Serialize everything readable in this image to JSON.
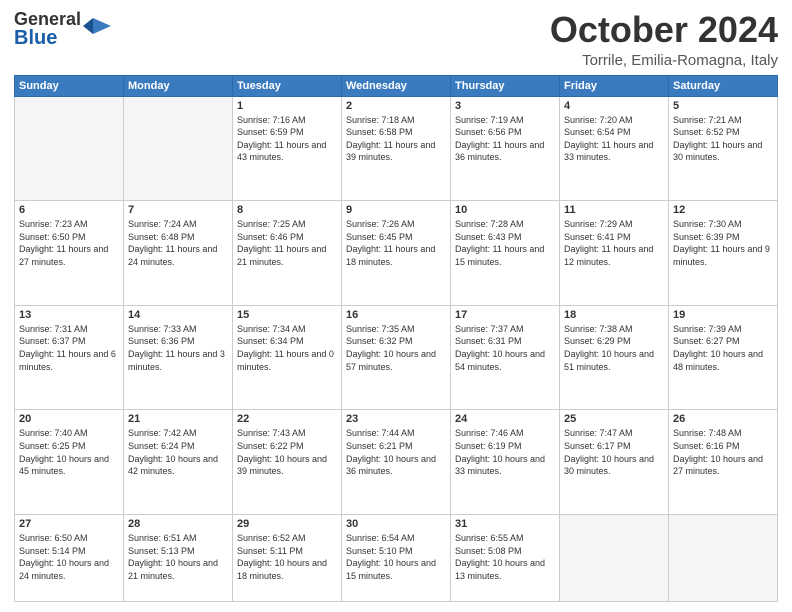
{
  "logo": {
    "general": "General",
    "blue": "Blue"
  },
  "header": {
    "month": "October 2024",
    "location": "Torrile, Emilia-Romagna, Italy"
  },
  "weekdays": [
    "Sunday",
    "Monday",
    "Tuesday",
    "Wednesday",
    "Thursday",
    "Friday",
    "Saturday"
  ],
  "weeks": [
    [
      {
        "day": "",
        "sunrise": "",
        "sunset": "",
        "daylight": "",
        "empty": true
      },
      {
        "day": "",
        "sunrise": "",
        "sunset": "",
        "daylight": "",
        "empty": true
      },
      {
        "day": "1",
        "sunrise": "Sunrise: 7:16 AM",
        "sunset": "Sunset: 6:59 PM",
        "daylight": "Daylight: 11 hours and 43 minutes.",
        "empty": false
      },
      {
        "day": "2",
        "sunrise": "Sunrise: 7:18 AM",
        "sunset": "Sunset: 6:58 PM",
        "daylight": "Daylight: 11 hours and 39 minutes.",
        "empty": false
      },
      {
        "day": "3",
        "sunrise": "Sunrise: 7:19 AM",
        "sunset": "Sunset: 6:56 PM",
        "daylight": "Daylight: 11 hours and 36 minutes.",
        "empty": false
      },
      {
        "day": "4",
        "sunrise": "Sunrise: 7:20 AM",
        "sunset": "Sunset: 6:54 PM",
        "daylight": "Daylight: 11 hours and 33 minutes.",
        "empty": false
      },
      {
        "day": "5",
        "sunrise": "Sunrise: 7:21 AM",
        "sunset": "Sunset: 6:52 PM",
        "daylight": "Daylight: 11 hours and 30 minutes.",
        "empty": false
      }
    ],
    [
      {
        "day": "6",
        "sunrise": "Sunrise: 7:23 AM",
        "sunset": "Sunset: 6:50 PM",
        "daylight": "Daylight: 11 hours and 27 minutes.",
        "empty": false
      },
      {
        "day": "7",
        "sunrise": "Sunrise: 7:24 AM",
        "sunset": "Sunset: 6:48 PM",
        "daylight": "Daylight: 11 hours and 24 minutes.",
        "empty": false
      },
      {
        "day": "8",
        "sunrise": "Sunrise: 7:25 AM",
        "sunset": "Sunset: 6:46 PM",
        "daylight": "Daylight: 11 hours and 21 minutes.",
        "empty": false
      },
      {
        "day": "9",
        "sunrise": "Sunrise: 7:26 AM",
        "sunset": "Sunset: 6:45 PM",
        "daylight": "Daylight: 11 hours and 18 minutes.",
        "empty": false
      },
      {
        "day": "10",
        "sunrise": "Sunrise: 7:28 AM",
        "sunset": "Sunset: 6:43 PM",
        "daylight": "Daylight: 11 hours and 15 minutes.",
        "empty": false
      },
      {
        "day": "11",
        "sunrise": "Sunrise: 7:29 AM",
        "sunset": "Sunset: 6:41 PM",
        "daylight": "Daylight: 11 hours and 12 minutes.",
        "empty": false
      },
      {
        "day": "12",
        "sunrise": "Sunrise: 7:30 AM",
        "sunset": "Sunset: 6:39 PM",
        "daylight": "Daylight: 11 hours and 9 minutes.",
        "empty": false
      }
    ],
    [
      {
        "day": "13",
        "sunrise": "Sunrise: 7:31 AM",
        "sunset": "Sunset: 6:37 PM",
        "daylight": "Daylight: 11 hours and 6 minutes.",
        "empty": false
      },
      {
        "day": "14",
        "sunrise": "Sunrise: 7:33 AM",
        "sunset": "Sunset: 6:36 PM",
        "daylight": "Daylight: 11 hours and 3 minutes.",
        "empty": false
      },
      {
        "day": "15",
        "sunrise": "Sunrise: 7:34 AM",
        "sunset": "Sunset: 6:34 PM",
        "daylight": "Daylight: 11 hours and 0 minutes.",
        "empty": false
      },
      {
        "day": "16",
        "sunrise": "Sunrise: 7:35 AM",
        "sunset": "Sunset: 6:32 PM",
        "daylight": "Daylight: 10 hours and 57 minutes.",
        "empty": false
      },
      {
        "day": "17",
        "sunrise": "Sunrise: 7:37 AM",
        "sunset": "Sunset: 6:31 PM",
        "daylight": "Daylight: 10 hours and 54 minutes.",
        "empty": false
      },
      {
        "day": "18",
        "sunrise": "Sunrise: 7:38 AM",
        "sunset": "Sunset: 6:29 PM",
        "daylight": "Daylight: 10 hours and 51 minutes.",
        "empty": false
      },
      {
        "day": "19",
        "sunrise": "Sunrise: 7:39 AM",
        "sunset": "Sunset: 6:27 PM",
        "daylight": "Daylight: 10 hours and 48 minutes.",
        "empty": false
      }
    ],
    [
      {
        "day": "20",
        "sunrise": "Sunrise: 7:40 AM",
        "sunset": "Sunset: 6:25 PM",
        "daylight": "Daylight: 10 hours and 45 minutes.",
        "empty": false
      },
      {
        "day": "21",
        "sunrise": "Sunrise: 7:42 AM",
        "sunset": "Sunset: 6:24 PM",
        "daylight": "Daylight: 10 hours and 42 minutes.",
        "empty": false
      },
      {
        "day": "22",
        "sunrise": "Sunrise: 7:43 AM",
        "sunset": "Sunset: 6:22 PM",
        "daylight": "Daylight: 10 hours and 39 minutes.",
        "empty": false
      },
      {
        "day": "23",
        "sunrise": "Sunrise: 7:44 AM",
        "sunset": "Sunset: 6:21 PM",
        "daylight": "Daylight: 10 hours and 36 minutes.",
        "empty": false
      },
      {
        "day": "24",
        "sunrise": "Sunrise: 7:46 AM",
        "sunset": "Sunset: 6:19 PM",
        "daylight": "Daylight: 10 hours and 33 minutes.",
        "empty": false
      },
      {
        "day": "25",
        "sunrise": "Sunrise: 7:47 AM",
        "sunset": "Sunset: 6:17 PM",
        "daylight": "Daylight: 10 hours and 30 minutes.",
        "empty": false
      },
      {
        "day": "26",
        "sunrise": "Sunrise: 7:48 AM",
        "sunset": "Sunset: 6:16 PM",
        "daylight": "Daylight: 10 hours and 27 minutes.",
        "empty": false
      }
    ],
    [
      {
        "day": "27",
        "sunrise": "Sunrise: 6:50 AM",
        "sunset": "Sunset: 5:14 PM",
        "daylight": "Daylight: 10 hours and 24 minutes.",
        "empty": false
      },
      {
        "day": "28",
        "sunrise": "Sunrise: 6:51 AM",
        "sunset": "Sunset: 5:13 PM",
        "daylight": "Daylight: 10 hours and 21 minutes.",
        "empty": false
      },
      {
        "day": "29",
        "sunrise": "Sunrise: 6:52 AM",
        "sunset": "Sunset: 5:11 PM",
        "daylight": "Daylight: 10 hours and 18 minutes.",
        "empty": false
      },
      {
        "day": "30",
        "sunrise": "Sunrise: 6:54 AM",
        "sunset": "Sunset: 5:10 PM",
        "daylight": "Daylight: 10 hours and 15 minutes.",
        "empty": false
      },
      {
        "day": "31",
        "sunrise": "Sunrise: 6:55 AM",
        "sunset": "Sunset: 5:08 PM",
        "daylight": "Daylight: 10 hours and 13 minutes.",
        "empty": false
      },
      {
        "day": "",
        "sunrise": "",
        "sunset": "",
        "daylight": "",
        "empty": true
      },
      {
        "day": "",
        "sunrise": "",
        "sunset": "",
        "daylight": "",
        "empty": true
      }
    ]
  ]
}
